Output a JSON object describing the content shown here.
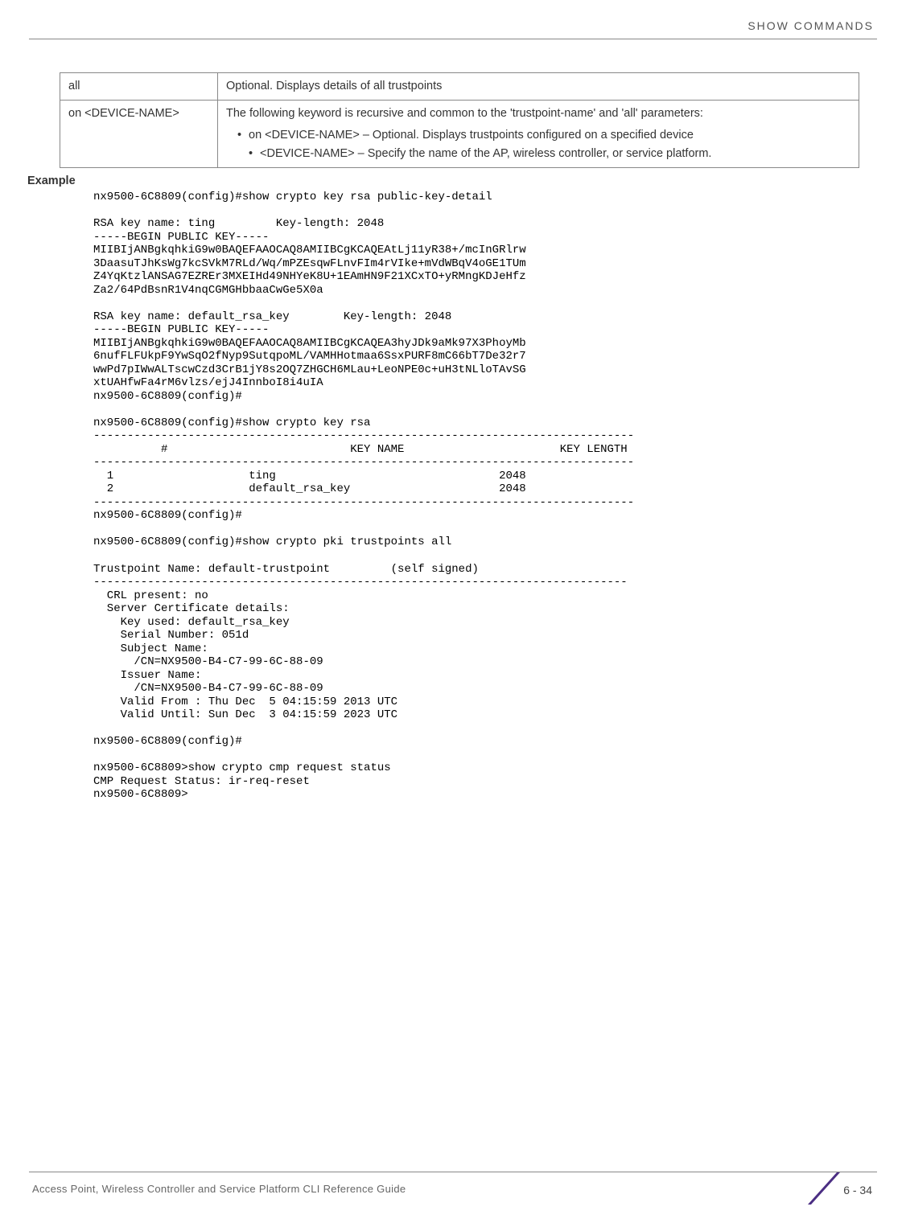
{
  "header": {
    "section_label": "SHOW COMMANDS"
  },
  "table": {
    "row1": {
      "col1": "all",
      "col2": "Optional. Displays details of all trustpoints"
    },
    "row2": {
      "col1": "on <DEVICE-NAME>",
      "intro": "The following keyword is recursive and common to the 'trustpoint-name' and 'all' parameters:",
      "b1": "on <DEVICE-NAME> – Optional. Displays trustpoints configured on a specified device",
      "b1s1": "<DEVICE-NAME> – Specify the name of the AP, wireless controller, or service platform."
    }
  },
  "example_heading": "Example",
  "terminal": "nx9500-6C8809(config)#show crypto key rsa public-key-detail\n\nRSA key name: ting         Key-length: 2048\n-----BEGIN PUBLIC KEY-----\nMIIBIjANBgkqhkiG9w0BAQEFAAOCAQ8AMIIBCgKCAQEAtLj11yR38+/mcInGRlrw\n3DaasuTJhKsWg7kcSVkM7RLd/Wq/mPZEsqwFLnvFIm4rVIke+mVdWBqV4oGE1TUm\nZ4YqKtzlANSAG7EZREr3MXEIHd49NHYeK8U+1EAmHN9F21XCxTO+yRMngKDJeHfz\nZa2/64PdBsnR1V4nqCGMGHbbaaCwGe5X0a\n\nRSA key name: default_rsa_key        Key-length: 2048\n-----BEGIN PUBLIC KEY-----\nMIIBIjANBgkqhkiG9w0BAQEFAAOCAQ8AMIIBCgKCAQEA3hyJDk9aMk97X3PhoyMb\n6nufFLFUkpF9YwSqO2fNyp9SutqpoML/VAMHHotmaa6SsxPURF8mC66bT7De32r7\nwwPd7pIWwALTscwCzd3CrB1jY8s2OQ7ZHGCH6MLau+LeoNPE0c+uH3tNLloTAvSG\nxtUAHfwFa4rM6vlzs/ejJ4InnboI8i4uIA\nnx9500-6C8809(config)#\n\nnx9500-6C8809(config)#show crypto key rsa\n--------------------------------------------------------------------------------\n          #                           KEY NAME                       KEY LENGTH\n--------------------------------------------------------------------------------\n  1                    ting                                 2048\n  2                    default_rsa_key                      2048\n--------------------------------------------------------------------------------\nnx9500-6C8809(config)#\n\nnx9500-6C8809(config)#show crypto pki trustpoints all\n\nTrustpoint Name: default-trustpoint         (self signed)\n-------------------------------------------------------------------------------\n  CRL present: no\n  Server Certificate details:\n    Key used: default_rsa_key\n    Serial Number: 051d\n    Subject Name:\n      /CN=NX9500-B4-C7-99-6C-88-09\n    Issuer Name:\n      /CN=NX9500-B4-C7-99-6C-88-09\n    Valid From : Thu Dec  5 04:15:59 2013 UTC\n    Valid Until: Sun Dec  3 04:15:59 2023 UTC\n\nnx9500-6C8809(config)#\n\nnx9500-6C8809>show crypto cmp request status\nCMP Request Status: ir-req-reset\nnx9500-6C8809>",
  "footer": {
    "text": "Access Point, Wireless Controller and Service Platform CLI Reference Guide",
    "page": "6 - 34"
  }
}
